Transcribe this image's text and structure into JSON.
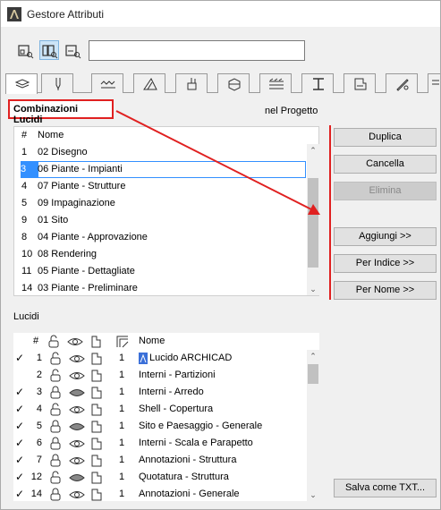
{
  "window": {
    "title": "Gestore Attributi"
  },
  "search": {
    "value": ""
  },
  "view_buttons": [
    "list-view-icon",
    "grid-view-icon",
    "detail-view-icon"
  ],
  "tabs": [
    "layers-icon",
    "pen-icon",
    "line-type-icon",
    "fill-icon",
    "surface-icon",
    "building-material-icon",
    "composite-icon",
    "profile-icon",
    "zone-icon",
    "mep-icon",
    "markup-icon"
  ],
  "combos": {
    "title": "Combinazioni Lucidi",
    "project_label": "nel Progetto",
    "header": {
      "num": "#",
      "name": "Nome"
    },
    "rows": [
      {
        "num": "1",
        "name": "02 Disegno"
      },
      {
        "num": "3",
        "name": "06 Piante - Impianti"
      },
      {
        "num": "4",
        "name": "07 Piante - Strutture"
      },
      {
        "num": "5",
        "name": "09 Impaginazione"
      },
      {
        "num": "9",
        "name": "01 Sito"
      },
      {
        "num": "8",
        "name": "04 Piante - Approvazione"
      },
      {
        "num": "10",
        "name": "08 Rendering"
      },
      {
        "num": "11",
        "name": "05 Piante - Dettagliate"
      },
      {
        "num": "14",
        "name": "03 Piante - Preliminare"
      }
    ],
    "selected_index": 1
  },
  "buttons": {
    "duplica": "Duplica",
    "cancella": "Cancella",
    "elimina": "Elimina",
    "aggiungi": "Aggiungi >>",
    "per_indice": "Per Indice >>",
    "per_nome": "Per Nome >>",
    "salva": "Salva come TXT..."
  },
  "lucidi": {
    "title": "Lucidi",
    "header": {
      "num": "#",
      "name": "Nome"
    },
    "rows": [
      {
        "checked": true,
        "num": "1",
        "lock": "open",
        "eye": "open",
        "pen": "1",
        "name": "Lucido ARCHICAD",
        "special": true
      },
      {
        "checked": false,
        "num": "2",
        "lock": "open",
        "eye": "open",
        "pen": "1",
        "name": "Interni - Partizioni"
      },
      {
        "checked": true,
        "num": "3",
        "lock": "closed",
        "eye": "closed",
        "pen": "1",
        "name": "Interni - Arredo"
      },
      {
        "checked": true,
        "num": "4",
        "lock": "open",
        "eye": "open",
        "pen": "1",
        "name": "Shell - Copertura"
      },
      {
        "checked": true,
        "num": "5",
        "lock": "closed",
        "eye": "closed",
        "pen": "1",
        "name": "Sito e Paesaggio - Generale"
      },
      {
        "checked": true,
        "num": "6",
        "lock": "closed",
        "eye": "open",
        "pen": "1",
        "name": "Interni - Scala e Parapetto"
      },
      {
        "checked": true,
        "num": "7",
        "lock": "closed",
        "eye": "open",
        "pen": "1",
        "name": "Annotazioni - Struttura"
      },
      {
        "checked": true,
        "num": "12",
        "lock": "open",
        "eye": "closed",
        "pen": "1",
        "name": "Quotatura - Struttura"
      },
      {
        "checked": true,
        "num": "14",
        "lock": "closed",
        "eye": "open",
        "pen": "1",
        "name": "Annotazioni - Generale"
      }
    ]
  },
  "colors": {
    "selection": "#3390ff",
    "highlight_red": "#e02020"
  }
}
